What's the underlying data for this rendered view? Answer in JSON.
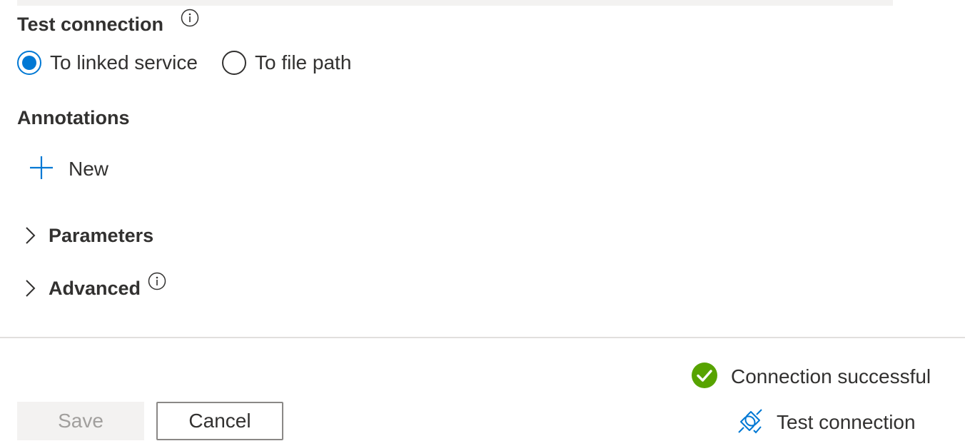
{
  "test_connection": {
    "title": "Test connection",
    "options": [
      {
        "label": "To linked service",
        "checked": true
      },
      {
        "label": "To file path",
        "checked": false
      }
    ]
  },
  "annotations": {
    "title": "Annotations",
    "new_label": "New"
  },
  "sections": {
    "parameters_label": "Parameters",
    "advanced_label": "Advanced"
  },
  "footer": {
    "status_text": "Connection successful",
    "save_label": "Save",
    "cancel_label": "Cancel",
    "test_connection_label": "Test connection"
  },
  "icons": {
    "info": "info-icon",
    "add": "plus-icon",
    "expand": "chevron-right-icon",
    "success": "checkmark-circle-icon",
    "test": "plug-connected-icon"
  },
  "colors": {
    "accent": "#0078d4",
    "success": "#57a300",
    "text": "#323130",
    "disabled_text": "#a19f9d",
    "disabled_bg": "#f3f2f1"
  }
}
